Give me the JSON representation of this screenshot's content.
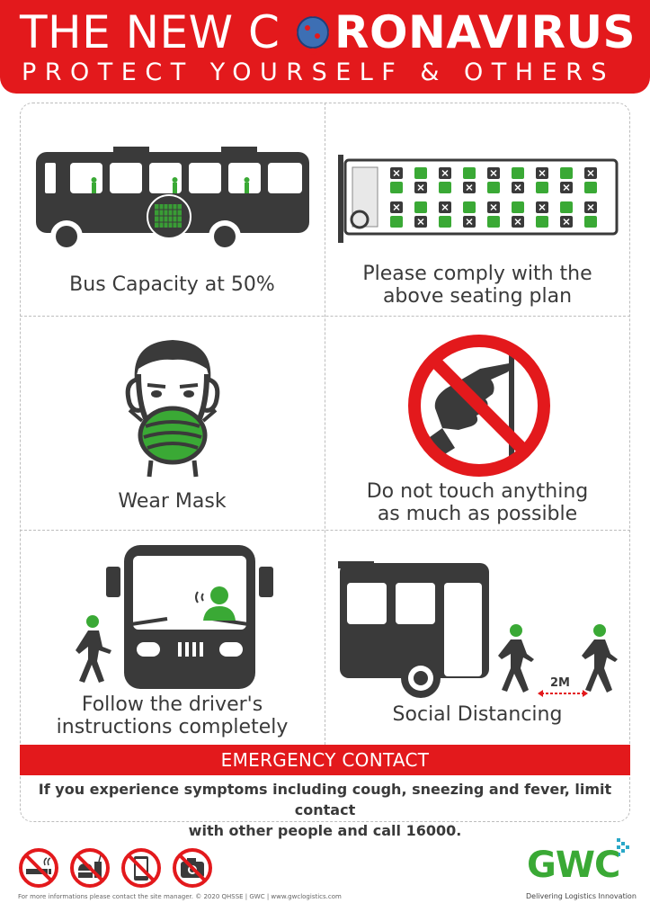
{
  "header": {
    "title_part1": "THE NEW C",
    "title_part2": "RONAVIRUS",
    "subtitle": "PROTECT YOURSELF & OTHERS"
  },
  "panels": [
    {
      "id": "bus-capacity",
      "caption": "Bus Capacity at 50%"
    },
    {
      "id": "seating-plan",
      "caption_line1": "Please comply with the",
      "caption_line2": "above seating plan"
    },
    {
      "id": "wear-mask",
      "caption": "Wear Mask"
    },
    {
      "id": "no-touch",
      "caption_line1": "Do not touch anything",
      "caption_line2": "as much as possible"
    },
    {
      "id": "follow-driver",
      "caption_line1": "Follow the driver's",
      "caption_line2": "instructions completely"
    },
    {
      "id": "social-distancing",
      "caption": "Social Distancing",
      "distance_label": "2M"
    }
  ],
  "emergency": {
    "title": "EMERGENCY CONTACT",
    "text_line1": "If you experience symptoms including cough, sneezing and fever, limit contact",
    "text_line2_prefix": "with other people and call ",
    "number": "16000",
    "text_line2_suffix": "."
  },
  "footer": {
    "prohibition_icons": [
      "no-smoking-icon",
      "no-food-drink-icon",
      "no-phone-icon",
      "no-camera-icon"
    ],
    "note": "For more informations please contact the site manager. © 2020 QHSSE | GWC | www.gwclogistics.com",
    "logo": "GWC",
    "logo_tagline": "Delivering Logistics Innovation"
  },
  "colors": {
    "red": "#e3191c",
    "green": "#3aa935",
    "dark": "#3a3a3a"
  }
}
